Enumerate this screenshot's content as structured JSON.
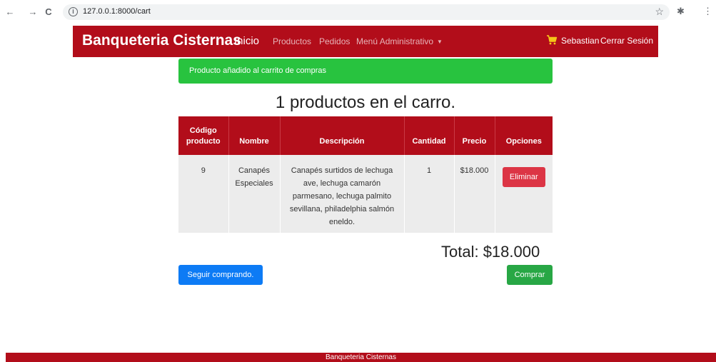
{
  "browser": {
    "url": "127.0.0.1:8000/cart",
    "back_icon": "←",
    "forward_icon": "→",
    "reload_icon": "C",
    "star_icon": "☆",
    "extensions_icon": "✱",
    "menu_icon": "⋮"
  },
  "navbar": {
    "brand": "Banqueteria Cisternas",
    "inicio": "Inicio",
    "productos": "Productos",
    "pedidos": "Pedidos",
    "admin_menu": "Menú Administrativo",
    "user": "Sebastian",
    "logout": "Cerrar Sesión",
    "color": "#b20d1a"
  },
  "alert": {
    "message": "Producto añadido al carrito de compras",
    "color": "#28c33f"
  },
  "page": {
    "heading": "1 productos en el carro."
  },
  "table": {
    "headers": [
      "Código producto",
      "Nombre",
      "Descripción",
      "Cantidad",
      "Precio",
      "Opciones"
    ],
    "rows": [
      {
        "code": "9",
        "name": "Canapés Especiales",
        "description": "Canapés surtidos de lechuga ave, lechuga camarón parmesano, lechuga palmito sevillana, philadelphia salmón eneldo.",
        "quantity": "1",
        "price": "$18.000",
        "action": "Eliminar"
      }
    ]
  },
  "total": "Total: $18.000",
  "buttons": {
    "continue": "Seguir comprando.",
    "buy": "Comprar"
  },
  "footer": {
    "text": "Banqueteria Cisternas"
  }
}
